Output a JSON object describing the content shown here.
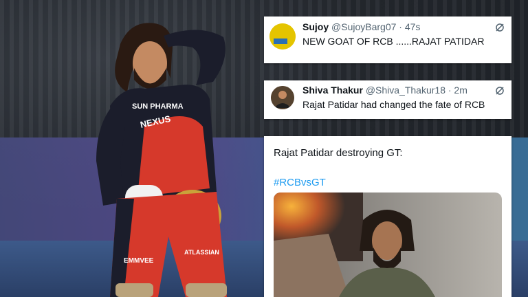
{
  "tweets": [
    {
      "name": "Sujoy",
      "handle": "@SujoyBarg07",
      "time": "· 47s",
      "text": "NEW GOAT OF RCB ......RAJAT PATIDAR",
      "avatar_color": "#e4c400",
      "icon": "grok-icon"
    },
    {
      "name": "Shiva Thakur",
      "handle": "@Shiva_Thakur18",
      "time": "· 2m",
      "text": "Rajat Patidar had changed the fate of RCB",
      "avatar_color": "#55422f",
      "icon": "grok-icon"
    },
    {
      "text": "Rajat Patidar destroying GT:",
      "hashtag": "#RCBvsGT",
      "hashtag_color": "#1d9bf0"
    }
  ],
  "jersey": {
    "sponsor_top": "SUN PHARMA",
    "sponsor_chest": "NEXUS",
    "sponsor_leg": "EMMVEE",
    "sponsor_leg2": "ATLASSIAN"
  },
  "colors": {
    "jersey_dark": "#1b1d2b",
    "jersey_red": "#d6392b",
    "helmet_gold": "#c9a23a"
  }
}
